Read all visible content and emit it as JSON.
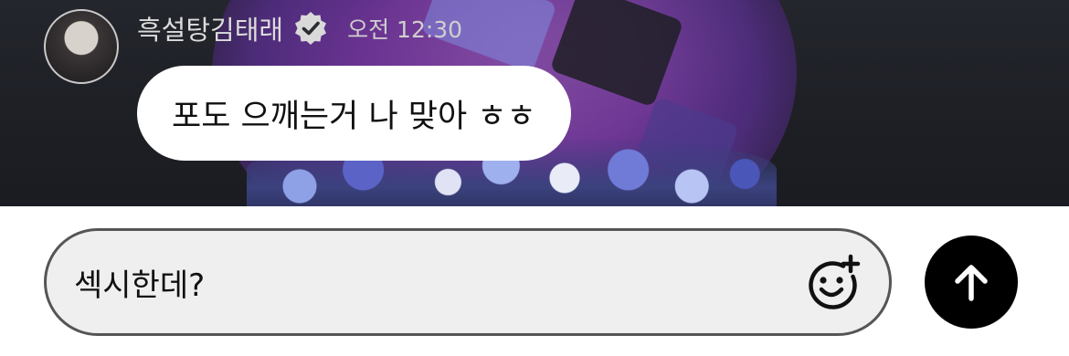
{
  "message": {
    "sender_name": "흑설탕김태래",
    "verified": true,
    "timestamp": "오전 12:30",
    "text": "포도 으깨는거 나 맞아 ㅎㅎ",
    "avatar_icon": "avatar-photo"
  },
  "composer": {
    "input_value": "섹시한데?",
    "emoji_button_icon": "emoji-add-icon"
  },
  "send_button": {
    "icon": "arrow-up-icon",
    "color": "#000000"
  },
  "colors": {
    "bubble": "#ffffff",
    "composer_bg": "#efefef",
    "chat_background": "#1d1f25"
  }
}
